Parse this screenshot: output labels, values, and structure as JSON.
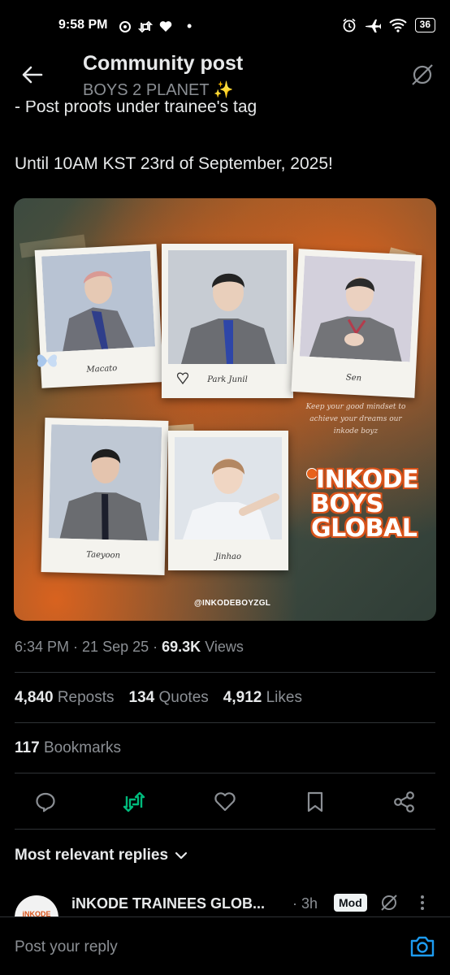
{
  "status_bar": {
    "time": "9:58 PM",
    "battery": "36",
    "left_icons": [
      "chat-icon",
      "repost-icon",
      "heart-icon",
      "dot-icon"
    ],
    "right_icons": [
      "alarm-icon",
      "airplane-icon",
      "wifi-icon",
      "battery-icon"
    ]
  },
  "header": {
    "title": "Community post",
    "subtitle": "BOYS 2 PLANET ✨"
  },
  "post": {
    "text_partial": "- Post proofs under trainee's tag",
    "text_main": "Until 10AM KST 23rd of September, 2025!",
    "image": {
      "captions": [
        "Macato",
        "Park Junil",
        "Sen",
        "Taeyoon",
        "Jinhao"
      ],
      "quote": "Keep your good mindset to achieve your dreams our inkode boyz",
      "logo_lines": [
        "INKODE",
        "BOYS",
        "GLOBAL"
      ],
      "handle": "@INKODEBOYZGL"
    },
    "meta": {
      "time": "6:34 PM",
      "date": "21 Sep 25",
      "views_count": "69.3K",
      "views_label": "Views"
    },
    "stats": {
      "reposts_count": "4,840",
      "reposts_label": "Reposts",
      "quotes_count": "134",
      "quotes_label": "Quotes",
      "likes_count": "4,912",
      "likes_label": "Likes"
    },
    "bookmarks": {
      "count": "117",
      "label": "Bookmarks"
    }
  },
  "actions": [
    "reply",
    "repost",
    "like",
    "bookmark",
    "share"
  ],
  "replies": {
    "sort_label": "Most relevant replies",
    "first_reply": {
      "name": "iNKODE TRAINEES GLOB...",
      "time": "· 3h",
      "badge": "Mod",
      "avatar_text": "iNKODE"
    }
  },
  "reply_bar": {
    "placeholder": "Post your reply"
  },
  "colors": {
    "accent": "#1d9bf0",
    "repost_active": "#00ba7c",
    "muted": "#8b8f94",
    "brand_orange": "#d9531a"
  }
}
